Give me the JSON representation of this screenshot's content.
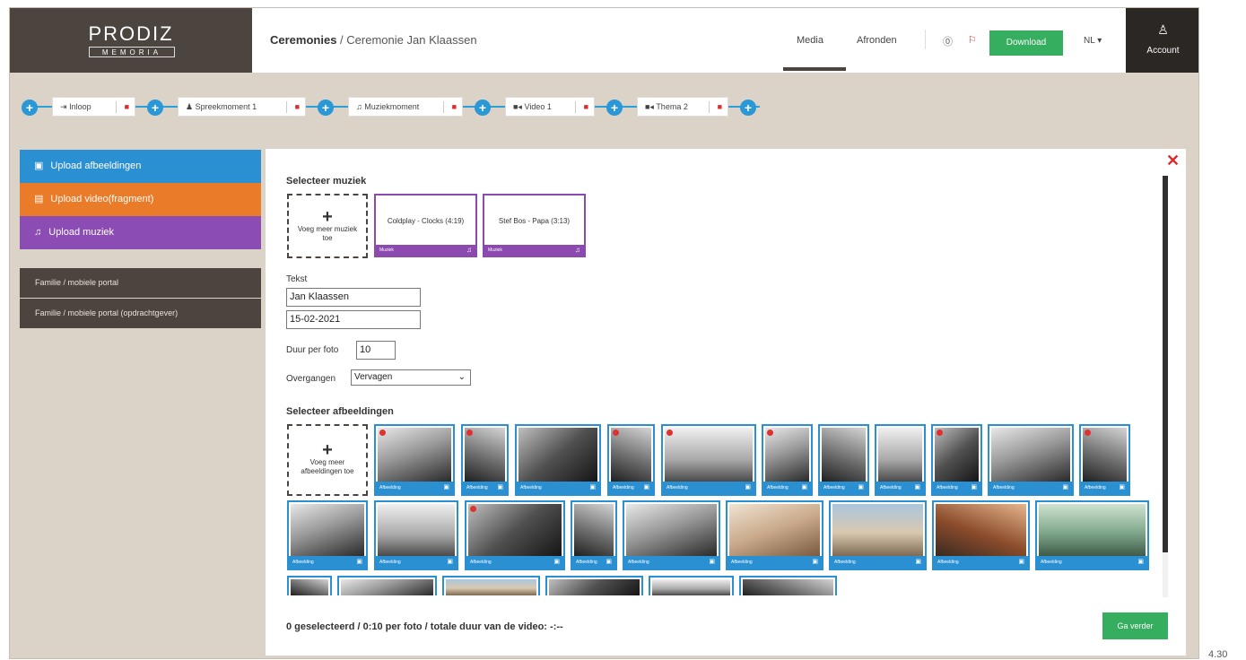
{
  "logo": {
    "line1": "PRODIZ",
    "line2": "MEMORIA"
  },
  "breadcrumb": {
    "root": "Ceremonies",
    "separator": "/",
    "current": "Ceremonie Jan Klaassen"
  },
  "topnav": {
    "media": "Media",
    "afronden": "Afronden",
    "help_icon": "help-icon",
    "balloon_icon": "balloon-icon",
    "download": "Download",
    "language": "NL ▾",
    "account": "Account"
  },
  "timeline": [
    {
      "label": "Inloop",
      "icon": "entry-icon"
    },
    {
      "label": "Spreekmoment 1",
      "icon": "speaker-icon"
    },
    {
      "label": "Muziekmoment",
      "icon": "music-icon"
    },
    {
      "label": "Video 1",
      "icon": "video-icon"
    },
    {
      "label": "Thema 2",
      "icon": "video-icon"
    }
  ],
  "sidebar": {
    "buttons": [
      {
        "label": "Upload afbeeldingen",
        "color": "#2a90d2",
        "icon": "image-icon"
      },
      {
        "label": "Upload video(fragment)",
        "color": "#ea7c29",
        "icon": "film-icon"
      },
      {
        "label": "Upload muziek",
        "color": "#8b4db3",
        "icon": "music-icon"
      }
    ],
    "portals": [
      {
        "label": "Familie / mobiele portal"
      },
      {
        "label": "Familie / mobiele portal (opdrachtgever)"
      }
    ]
  },
  "panel": {
    "music_title": "Selecteer muziek",
    "add_music": "Voeg meer muziek toe",
    "music": [
      {
        "title": "Coldplay - Clocks (4:19)",
        "tag": "Muziek"
      },
      {
        "title": "Stef Bos - Papa (3:13)",
        "tag": "Muziek"
      }
    ],
    "text_label": "Tekst",
    "text_name": "Jan Klaassen",
    "text_date": "15-02-2021",
    "duration_label": "Duur per foto",
    "duration_value": "10",
    "transition_label": "Overgangen",
    "transition_value": "Vervagen",
    "images_title": "Selecteer afbeeldingen",
    "add_images": "Voeg meer afbeeldingen toe",
    "image_tag": "Afbeelding",
    "status": "0 geselecteerd / 0:10 per foto / totale duur van de video: -:--",
    "next": "Ga verder"
  },
  "colors": {
    "accent_blue": "#2a90d2",
    "green": "#36ae5f",
    "purple": "#8c4ab0",
    "orange": "#ea7c29",
    "brown": "#4c453f",
    "red": "#e02a2a"
  },
  "page_number": "4.30"
}
